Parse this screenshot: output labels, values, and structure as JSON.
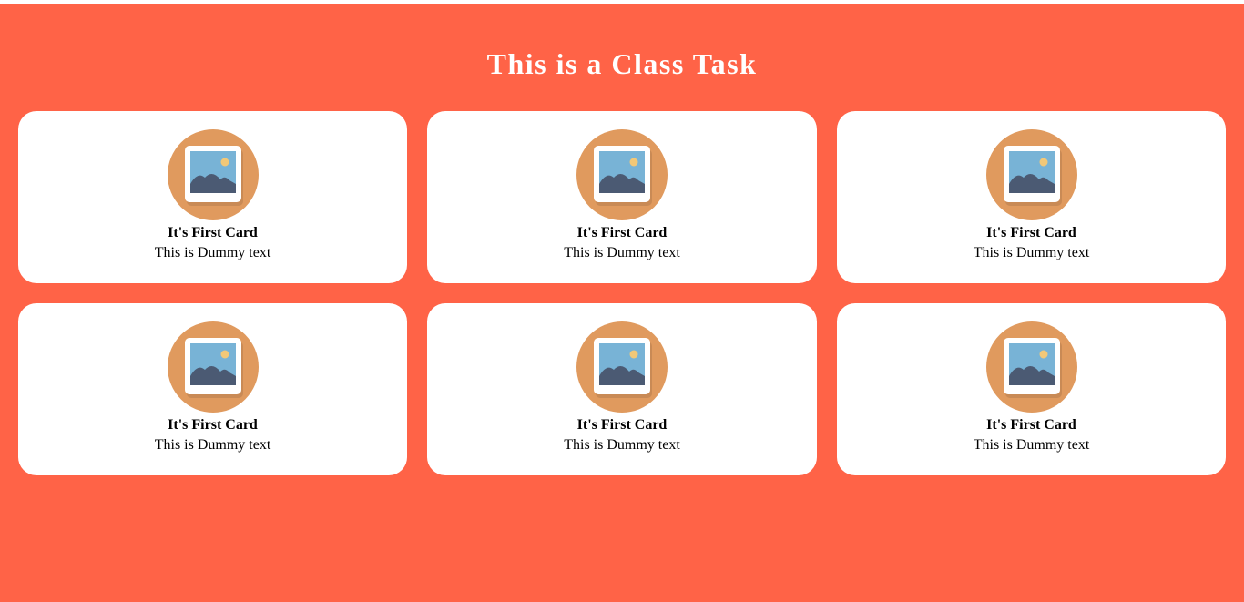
{
  "page": {
    "title": "This is a Class Task",
    "background_color": "#ff6347"
  },
  "cards": [
    {
      "icon": "image-placeholder-icon",
      "title": "It's First Card",
      "text": "This is Dummy text"
    },
    {
      "icon": "image-placeholder-icon",
      "title": "It's First Card",
      "text": "This is Dummy text"
    },
    {
      "icon": "image-placeholder-icon",
      "title": "It's First Card",
      "text": "This is Dummy text"
    },
    {
      "icon": "image-placeholder-icon",
      "title": "It's First Card",
      "text": "This is Dummy text"
    },
    {
      "icon": "image-placeholder-icon",
      "title": "It's First Card",
      "text": "This is Dummy text"
    },
    {
      "icon": "image-placeholder-icon",
      "title": "It's First Card",
      "text": "This is Dummy text"
    }
  ],
  "colors": {
    "icon_circle": "#e09a5e",
    "icon_frame": "#ffffff",
    "icon_sky": "#78b3d6",
    "icon_mountain": "#4b5a73",
    "icon_sun": "#f2c878"
  }
}
